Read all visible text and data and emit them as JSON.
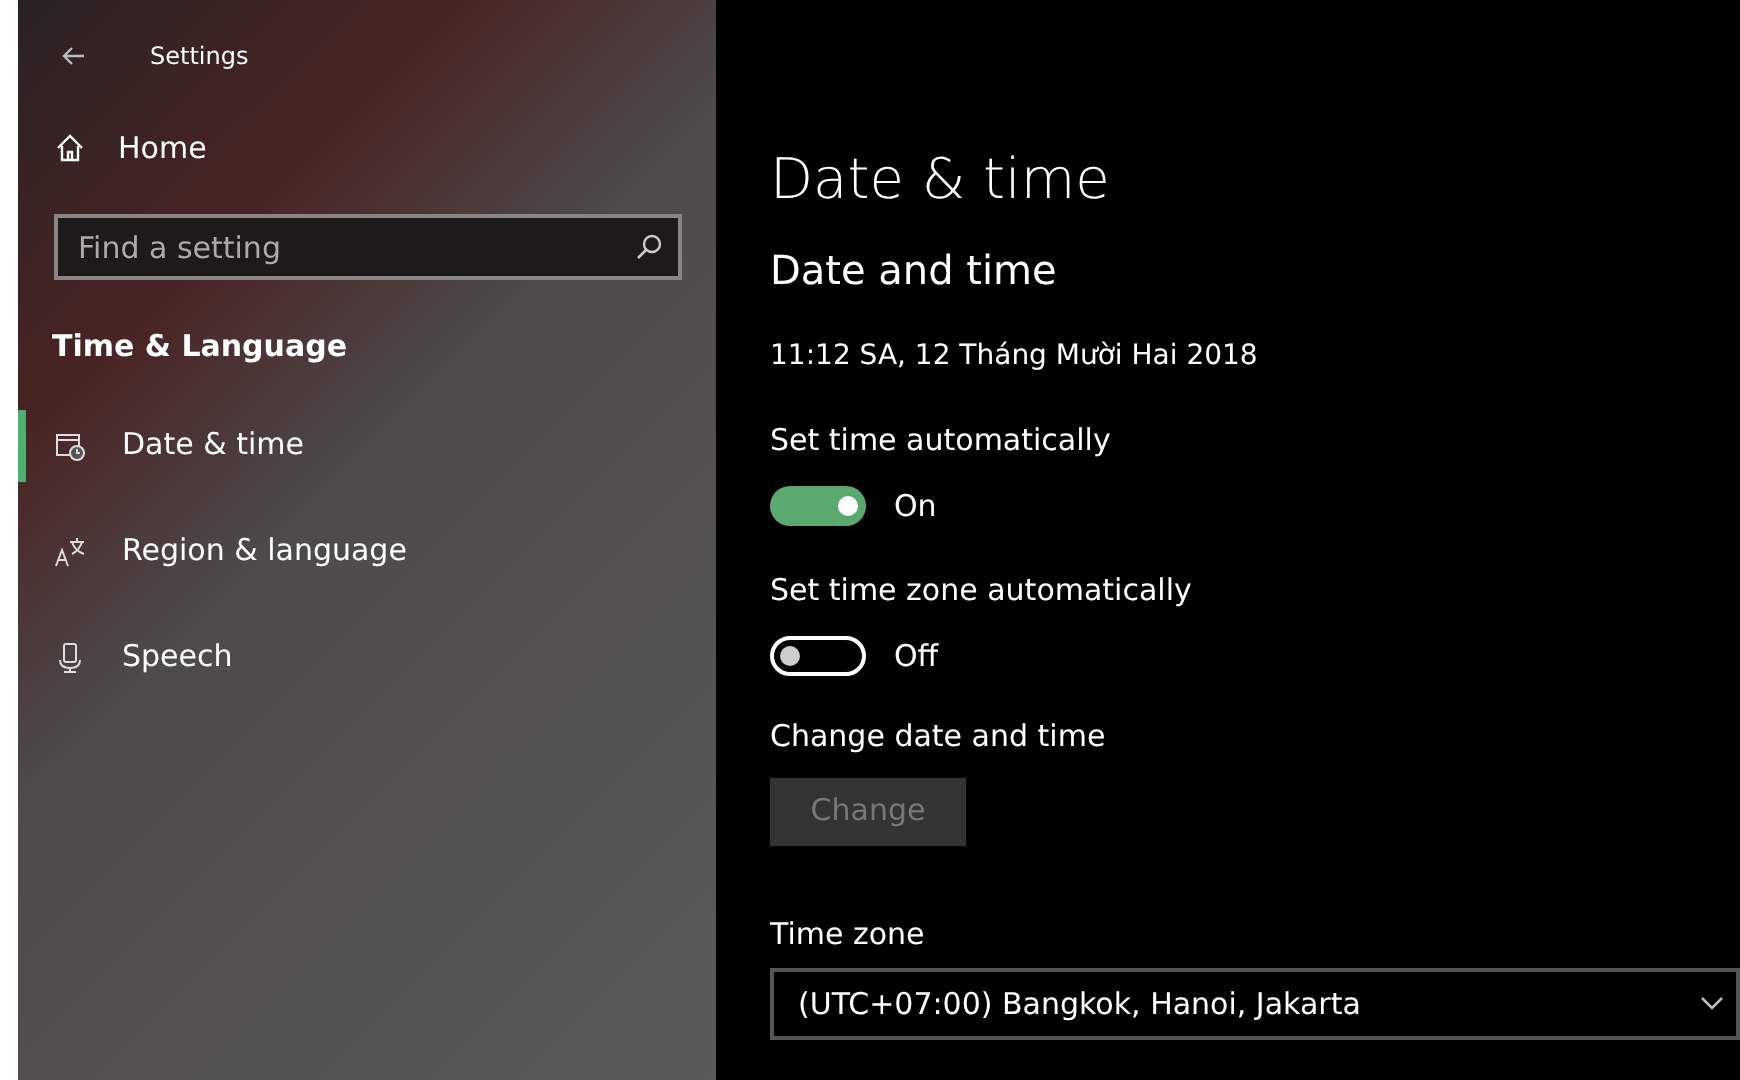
{
  "window": {
    "title": "Settings"
  },
  "sidebar": {
    "home": "Home",
    "search": {
      "placeholder": "Find a setting"
    },
    "section": "Time & Language",
    "items": [
      {
        "label": "Date & time",
        "selected": true,
        "kind": "calendar"
      },
      {
        "label": "Region & language",
        "selected": false,
        "kind": "language"
      },
      {
        "label": "Speech",
        "selected": false,
        "kind": "microphone"
      }
    ]
  },
  "main": {
    "title": "Date & time",
    "subtitle": "Date and time",
    "current_time": "11:12 SA, 12 Tháng Mười Hai 2018",
    "toggles": [
      {
        "label": "Set time automatically",
        "on": true,
        "state_text": "On"
      },
      {
        "label": "Set time zone automatically",
        "on": false,
        "state_text": "Off"
      }
    ],
    "change": {
      "label": "Change date and time",
      "button": {
        "label": "Change",
        "disabled": true
      }
    },
    "time_zone": {
      "label": "Time zone",
      "value": "(UTC+07:00) Bangkok, Hanoi, Jakarta"
    }
  }
}
